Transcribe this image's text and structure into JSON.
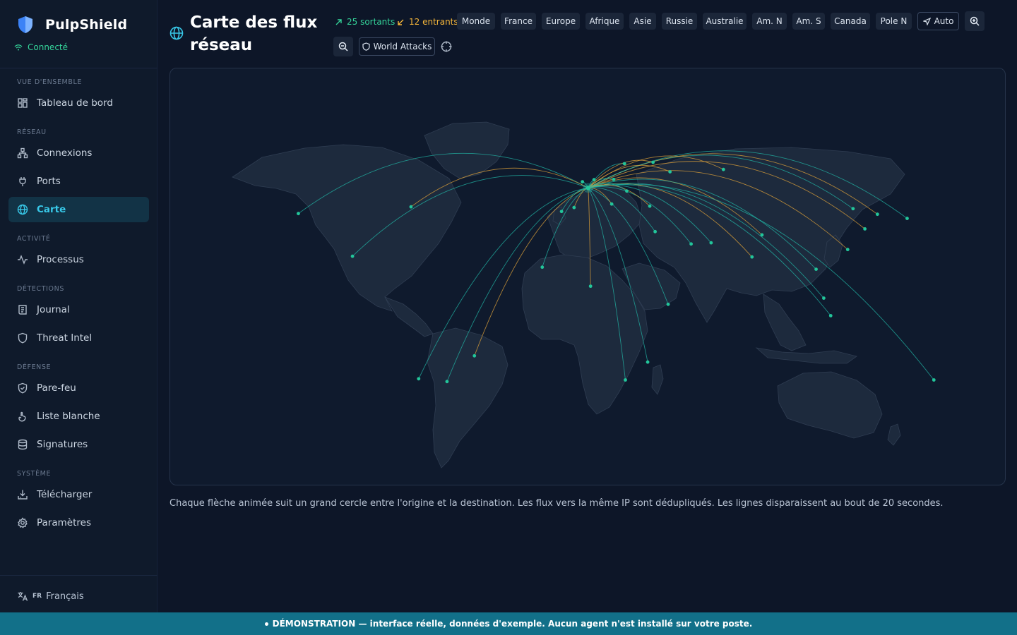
{
  "app": {
    "name": "PulpShield",
    "status": "Connecté"
  },
  "sidebar": {
    "sections": [
      {
        "label": "VUE D'ENSEMBLE",
        "items": [
          {
            "label": "Tableau de bord",
            "icon": "dashboard-icon"
          }
        ]
      },
      {
        "label": "RÉSEAU",
        "items": [
          {
            "label": "Connexions",
            "icon": "network-icon"
          },
          {
            "label": "Ports",
            "icon": "plug-icon"
          },
          {
            "label": "Carte",
            "icon": "globe-icon",
            "active": true
          }
        ]
      },
      {
        "label": "ACTIVITÉ",
        "items": [
          {
            "label": "Processus",
            "icon": "activity-icon"
          }
        ]
      },
      {
        "label": "DÉTECTIONS",
        "items": [
          {
            "label": "Journal",
            "icon": "scroll-icon"
          },
          {
            "label": "Threat Intel",
            "icon": "shield-icon"
          }
        ]
      },
      {
        "label": "DÉFENSE",
        "items": [
          {
            "label": "Pare-feu",
            "icon": "shield-check-icon"
          },
          {
            "label": "Liste blanche",
            "icon": "hand-icon"
          },
          {
            "label": "Signatures",
            "icon": "database-icon"
          }
        ]
      },
      {
        "label": "SYSTÈME",
        "items": [
          {
            "label": "Télécharger",
            "icon": "download-icon"
          },
          {
            "label": "Paramètres",
            "icon": "gear-icon"
          }
        ]
      }
    ],
    "language": {
      "code": "FR",
      "label": "Français"
    }
  },
  "header": {
    "title": "Carte des flux réseau",
    "outgoing": "25 sortants",
    "incoming": "12 entrants",
    "regions": [
      "Monde",
      "France",
      "Europe",
      "Afrique",
      "Asie",
      "Russie",
      "Australie",
      "Am. N",
      "Am. S",
      "Canada",
      "Pole N"
    ],
    "auto_label": "Auto",
    "world_attacks_label": "World Attacks"
  },
  "map": {
    "origin": {
      "lon": 2.35,
      "lat": 48.86
    },
    "flows": [
      {
        "lon": -122.4,
        "lat": 37.8,
        "dir": "out"
      },
      {
        "lon": -73.9,
        "lat": 40.7,
        "dir": "in"
      },
      {
        "lon": -99.1,
        "lat": 19.4,
        "dir": "out"
      },
      {
        "lon": -46.6,
        "lat": -23.5,
        "dir": "in"
      },
      {
        "lon": -58.4,
        "lat": -34.6,
        "dir": "out"
      },
      {
        "lon": -70.6,
        "lat": -33.4,
        "dir": "out"
      },
      {
        "lon": -17.4,
        "lat": 14.7,
        "dir": "out"
      },
      {
        "lon": 3.4,
        "lat": 6.5,
        "dir": "in"
      },
      {
        "lon": 36.8,
        "lat": -1.3,
        "dir": "out"
      },
      {
        "lon": 28.0,
        "lat": -26.2,
        "dir": "out"
      },
      {
        "lon": 18.4,
        "lat": -33.9,
        "dir": "out"
      },
      {
        "lon": 31.2,
        "lat": 30.0,
        "dir": "out"
      },
      {
        "lon": 46.7,
        "lat": 24.7,
        "dir": "out"
      },
      {
        "lon": 55.3,
        "lat": 25.2,
        "dir": "out"
      },
      {
        "lon": 72.9,
        "lat": 19.1,
        "dir": "in"
      },
      {
        "lon": 77.2,
        "lat": 28.6,
        "dir": "in"
      },
      {
        "lon": 100.5,
        "lat": 13.8,
        "dir": "out"
      },
      {
        "lon": 103.8,
        "lat": 1.35,
        "dir": "out"
      },
      {
        "lon": 106.8,
        "lat": -6.2,
        "dir": "out"
      },
      {
        "lon": 114.1,
        "lat": 22.3,
        "dir": "in"
      },
      {
        "lon": 121.5,
        "lat": 31.2,
        "dir": "in"
      },
      {
        "lon": 116.4,
        "lat": 39.9,
        "dir": "out"
      },
      {
        "lon": 126.9,
        "lat": 37.5,
        "dir": "in"
      },
      {
        "lon": 139.7,
        "lat": 35.7,
        "dir": "out"
      },
      {
        "lon": 151.2,
        "lat": -33.9,
        "dir": "out"
      },
      {
        "lon": -0.1,
        "lat": 51.5,
        "dir": "out"
      },
      {
        "lon": 13.4,
        "lat": 52.5,
        "dir": "out"
      },
      {
        "lon": 18.0,
        "lat": 59.3,
        "dir": "out"
      },
      {
        "lon": 37.6,
        "lat": 55.8,
        "dir": "in"
      },
      {
        "lon": -3.7,
        "lat": 40.4,
        "dir": "in"
      },
      {
        "lon": 12.5,
        "lat": 41.9,
        "dir": "in"
      },
      {
        "lon": 28.9,
        "lat": 41.0,
        "dir": "in"
      },
      {
        "lon": 4.9,
        "lat": 52.4,
        "dir": "out"
      },
      {
        "lon": -9.1,
        "lat": 38.7,
        "dir": "out"
      },
      {
        "lon": 60.6,
        "lat": 56.8,
        "dir": "in"
      },
      {
        "lon": 30.3,
        "lat": 59.9,
        "dir": "in"
      },
      {
        "lon": 19.0,
        "lat": 47.5,
        "dir": "out"
      }
    ],
    "colors": {
      "out": "#22b5a6",
      "in": "#e0a33a",
      "dot": "#22c59a",
      "land": "#1d2a3d",
      "border": "#2f3d52"
    }
  },
  "caption": "Chaque flèche animée suit un grand cercle entre l'origine et la destination. Les flux vers la même IP sont dédupliqués. Les lignes disparaissent au bout de 20 secondes.",
  "banner": "DÉMONSTRATION — interface réelle, données d'exemple. Aucun agent n'est installé sur votre poste."
}
